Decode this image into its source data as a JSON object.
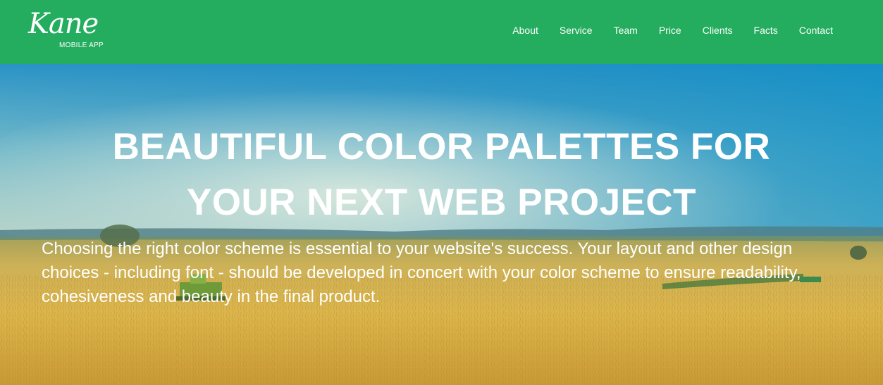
{
  "brand": {
    "logo_text": "Kane",
    "tagline": "MOBILE APP"
  },
  "nav": {
    "items": [
      "About",
      "Service",
      "Team",
      "Price",
      "Clients",
      "Facts",
      "Contact"
    ]
  },
  "hero": {
    "title": "BEAUTIFUL COLOR PALETTES FOR YOUR NEXT WEB PROJECT",
    "body": "Choosing the right color scheme is essential to your website's success. Your layout and other design choices - including font - should be developed in concert with your color scheme to ensure readability, cohesiveness and beauty in the final product."
  },
  "colors": {
    "nav_bg": "#24ad5e",
    "text": "#ffffff",
    "sky_top": "#1b8ec9",
    "field": "#d9b248"
  }
}
